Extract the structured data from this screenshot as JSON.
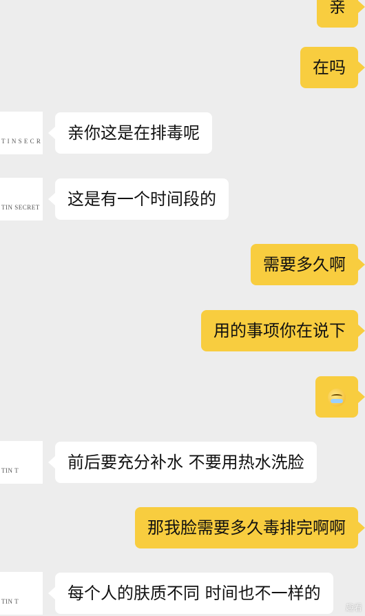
{
  "chat": {
    "messages": [
      {
        "side": "right",
        "text": "亲"
      },
      {
        "side": "right",
        "text": "在吗"
      },
      {
        "side": "left",
        "text": "亲你这是在排毒呢",
        "avatar_text": "T I N   S E C R E T"
      },
      {
        "side": "left",
        "text": "这是有一个时间段的",
        "avatar_text": "TIN SECRET"
      },
      {
        "side": "right",
        "text": "需要多久啊"
      },
      {
        "side": "right",
        "text": "用的事项你在说下"
      },
      {
        "side": "right",
        "emoji": "grinning-tears-emoji"
      },
      {
        "side": "left",
        "text": "前后要充分补水 不要用热水洗脸",
        "avatar_text": "TIN         T"
      },
      {
        "side": "right",
        "text": "那我脸需要多久毒排完啊啊"
      },
      {
        "side": "left",
        "text": "每个人的肤质不同 时间也不一样的",
        "avatar_text": "TIN         T"
      }
    ]
  },
  "watermark": "趣看"
}
